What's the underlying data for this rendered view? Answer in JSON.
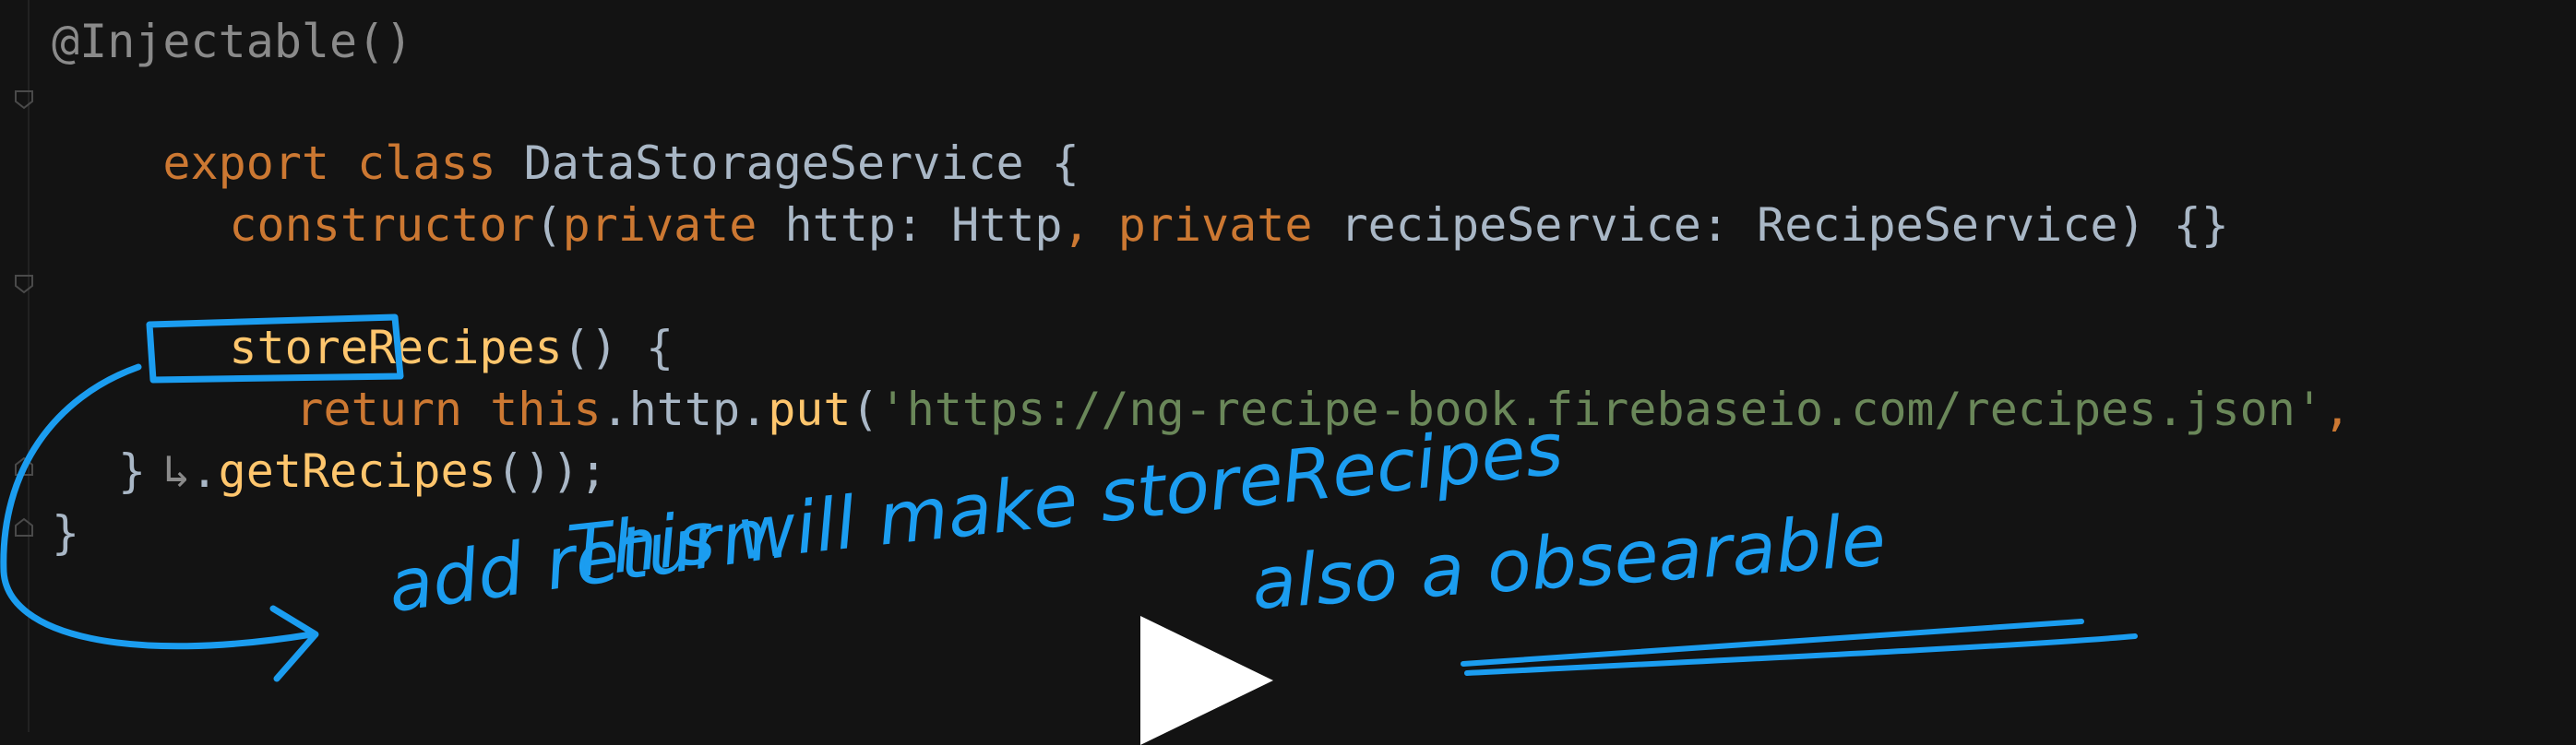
{
  "code": {
    "line1": "@Injectable()",
    "line2": [
      "export",
      " class",
      " DataStorageService {"
    ],
    "line3": [
      "constructor",
      "(",
      "private",
      " http: Http",
      ", ",
      "private",
      " recipeService: RecipeService) {}"
    ],
    "line5": [
      "storeRecipes",
      "() {"
    ],
    "line6": [
      "return",
      " ",
      "this",
      ".http.",
      "put",
      "(",
      "'https://ng-recipe-book.firebaseio.com/recipes.json'",
      ","
    ],
    "line7": [
      "↳",
      ".",
      "getRecipes",
      "());"
    ],
    "line8": "}",
    "line9": "}"
  },
  "annotation": {
    "line1": "add return.",
    "line2": "This will make storeRecipes",
    "line3": "also a obsearable"
  },
  "colors": {
    "ink": "#1b9df0",
    "keyword": "#cc7832",
    "string": "#6a8759",
    "function": "#ffc66d",
    "text": "#a9b7c6"
  },
  "icons": {
    "play": "play-icon",
    "fold": "fold-marker-icon"
  }
}
